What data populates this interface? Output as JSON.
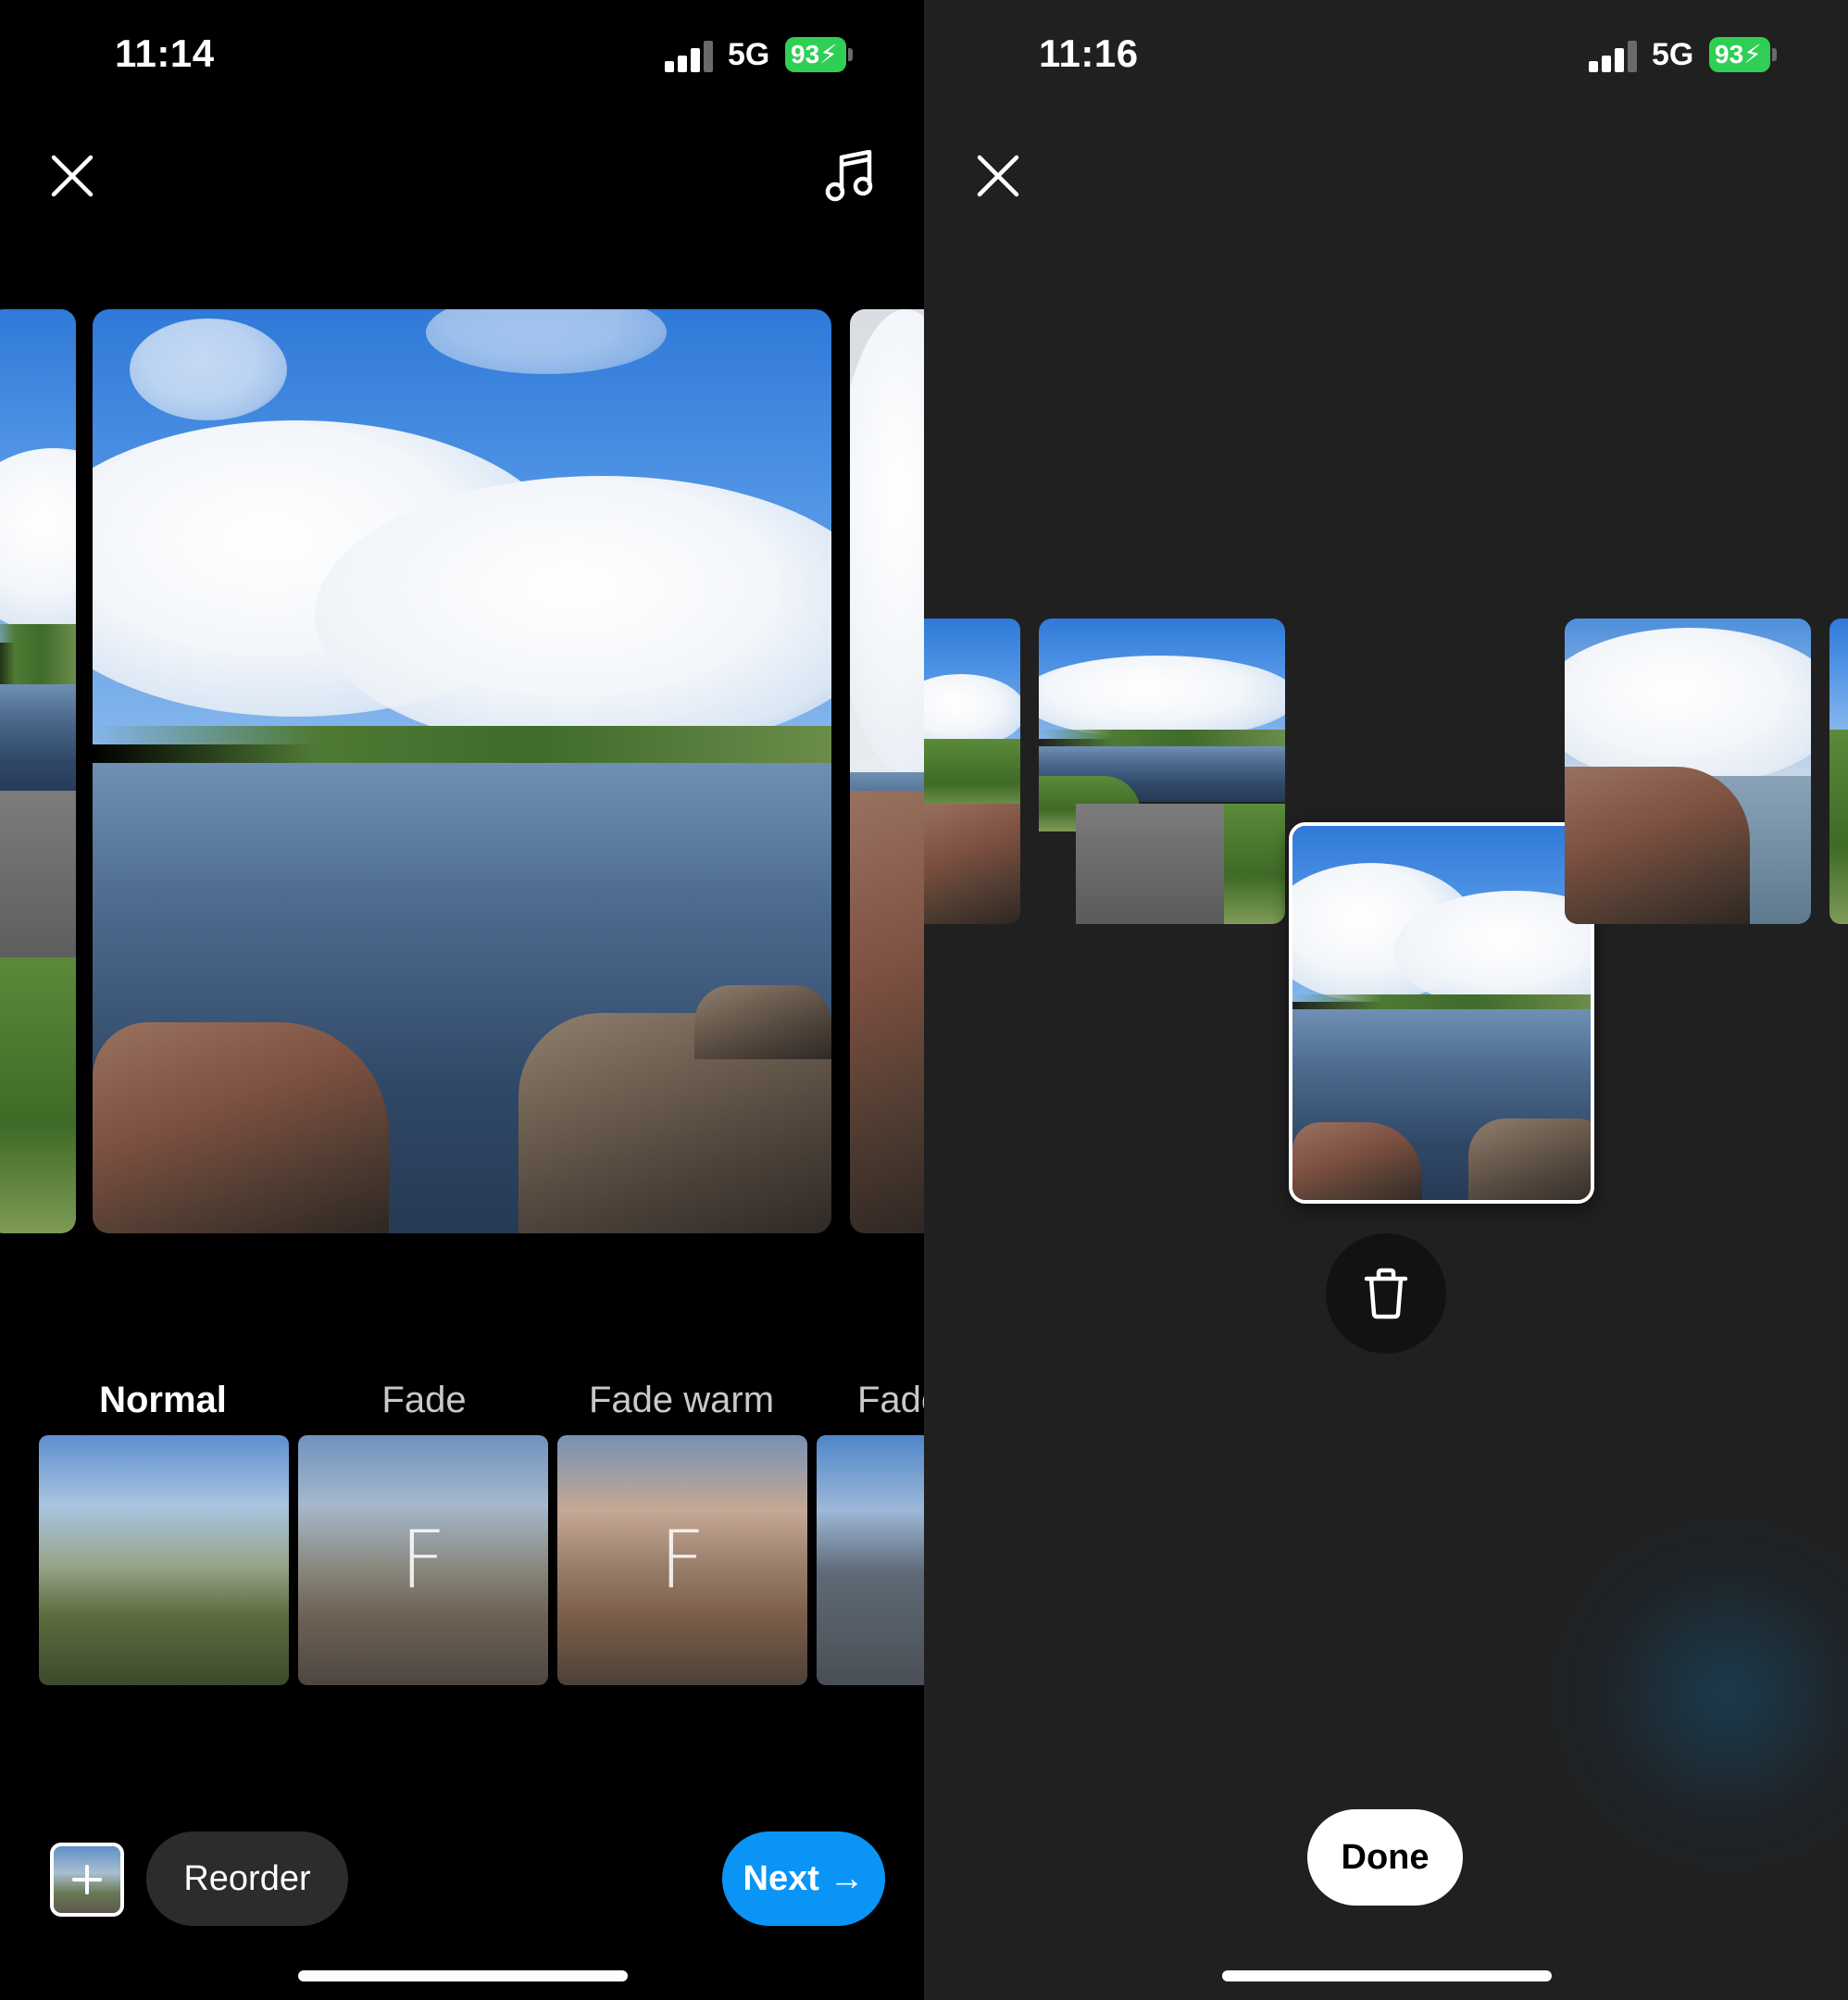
{
  "left": {
    "status": {
      "time": "11:14",
      "network": "5G",
      "battery": "93"
    },
    "close_icon": "close-icon",
    "music_icon": "music-note-icon",
    "filters": [
      {
        "label": "Normal",
        "active": true,
        "letter": ""
      },
      {
        "label": "Fade",
        "active": false,
        "letter": "F"
      },
      {
        "label": "Fade warm",
        "active": false,
        "letter": "F"
      },
      {
        "label": "Fade",
        "active": false,
        "letter": ""
      }
    ],
    "bottom": {
      "add_icon": "plus-icon",
      "reorder_label": "Reorder",
      "next_label": "Next →"
    },
    "colors": {
      "next_button": "#0a95f6",
      "reorder_button": "#2c2c2c"
    }
  },
  "right": {
    "status": {
      "time": "11:16",
      "network": "5G",
      "battery": "93"
    },
    "close_icon": "close-icon",
    "trash_icon": "trash-icon",
    "done_label": "Done",
    "colors": {
      "background": "#202020",
      "selected_border": "#ffffff"
    }
  }
}
